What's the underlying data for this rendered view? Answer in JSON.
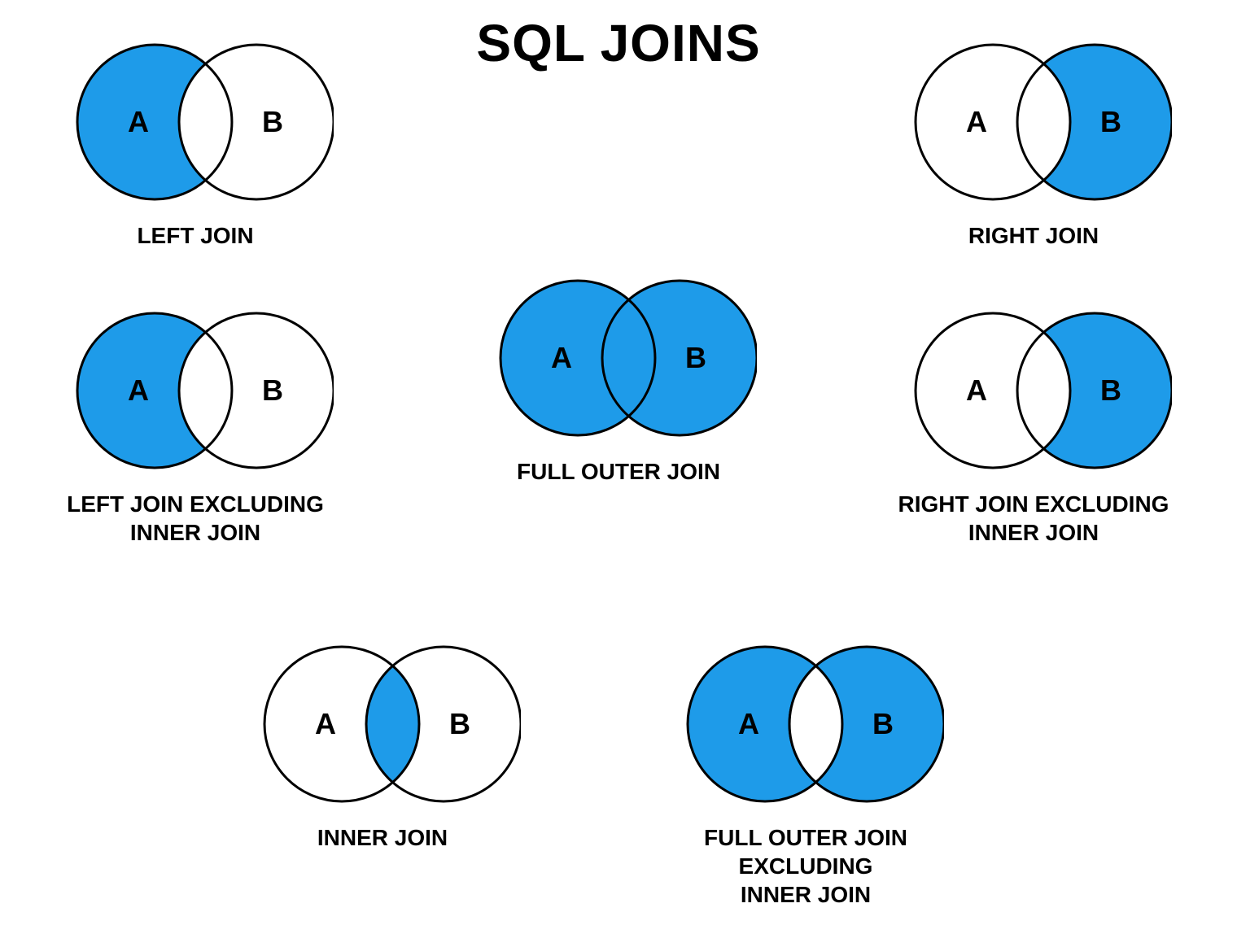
{
  "title": "SQL JOINS",
  "labels": {
    "a": "A",
    "b": "B"
  },
  "colors": {
    "fill": "#1e9be9",
    "stroke": "#000000",
    "bg": "#ffffff"
  },
  "joins": {
    "left": {
      "caption": "LEFT JOIN"
    },
    "right": {
      "caption": "RIGHT JOIN"
    },
    "left_excl": {
      "caption": "LEFT JOIN EXCLUDING\nINNER JOIN"
    },
    "full": {
      "caption": "FULL OUTER JOIN"
    },
    "right_excl": {
      "caption": "RIGHT JOIN EXCLUDING\nINNER JOIN"
    },
    "inner": {
      "caption": "INNER JOIN"
    },
    "full_excl": {
      "caption": "FULL OUTER JOIN EXCLUDING\nINNER JOIN"
    }
  }
}
